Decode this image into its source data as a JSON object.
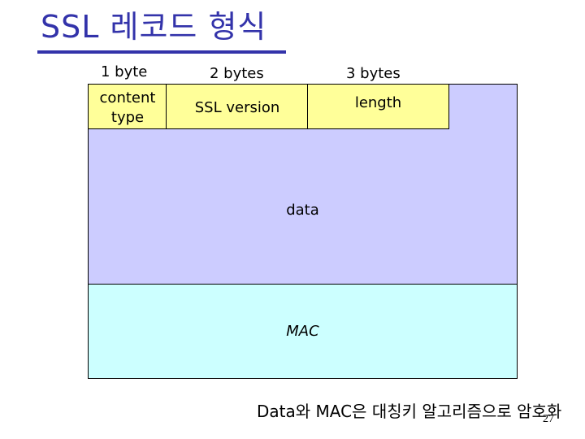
{
  "slide": {
    "title": "SSL 레코드 형식",
    "page_number": "27",
    "caption": "Data와 MAC은 대칭키 알고리즘으로 암호화"
  },
  "record": {
    "size_labels": [
      "1 byte",
      "2 bytes",
      "3 bytes"
    ],
    "header_fields": [
      {
        "label_line1": "content",
        "label_line2": "type",
        "size": "1 byte"
      },
      {
        "label_line1": "SSL version",
        "label_line2": "",
        "size": "2 bytes"
      },
      {
        "label_line1": "length",
        "label_line2": "",
        "size": "3 bytes"
      }
    ],
    "data_label": "data",
    "mac_label": "MAC"
  },
  "colors": {
    "title": "#3333aa",
    "header_fill": "#ffff99",
    "data_fill": "#ccccff",
    "mac_fill": "#ccffff"
  }
}
